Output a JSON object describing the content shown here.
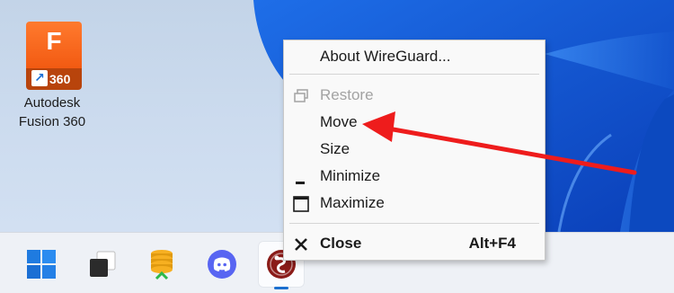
{
  "desktop": {
    "icon": {
      "tile_letter": "F",
      "tile_badge": "360",
      "shortcut_glyph": "↗",
      "label_line1": "Autodesk",
      "label_line2": "Fusion 360",
      "icon_name": "autodesk-fusion-360-icon"
    }
  },
  "context_menu": {
    "items": [
      {
        "label": "About WireGuard...",
        "enabled": true
      },
      {
        "label": "Restore",
        "enabled": false,
        "icon": "restore-icon"
      },
      {
        "label": "Move",
        "enabled": true
      },
      {
        "label": "Size",
        "enabled": true
      },
      {
        "label": "Minimize",
        "enabled": true,
        "icon": "minimize-icon"
      },
      {
        "label": "Maximize",
        "enabled": true,
        "icon": "maximize-icon"
      },
      {
        "label": "Close",
        "enabled": true,
        "icon": "close-icon",
        "accelerator": "Alt+F4",
        "bold": true
      }
    ]
  },
  "taskbar": {
    "apps": [
      {
        "name": "start-button",
        "icon": "windows-logo-icon"
      },
      {
        "name": "task-view-button",
        "icon": "task-view-icon"
      },
      {
        "name": "taskbar-app-coins",
        "icon": "coins-icon"
      },
      {
        "name": "taskbar-app-discord",
        "icon": "discord-icon"
      },
      {
        "name": "taskbar-app-wireguard",
        "icon": "wireguard-icon",
        "active": true
      }
    ]
  },
  "colors": {
    "annotation_arrow": "#ee1c1c",
    "accent": "#1b6fcf",
    "fusion_orange": "#f25a12"
  }
}
